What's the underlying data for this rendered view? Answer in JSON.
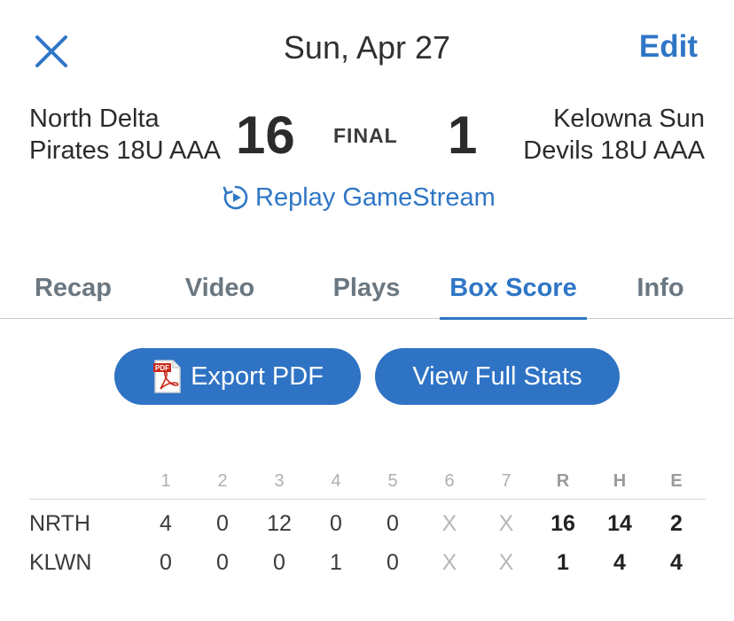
{
  "header": {
    "date": "Sun, Apr 27",
    "edit_label": "Edit",
    "close_icon": "close-icon"
  },
  "game": {
    "home_team_line1": "North Delta",
    "home_team_line2": "Pirates 18U AAA",
    "home_score": "16",
    "status": "FINAL",
    "away_score": "1",
    "away_team_line1": "Kelowna Sun",
    "away_team_line2": "Devils 18U AAA",
    "replay_label": "Replay GameStream",
    "replay_icon": "replay-icon"
  },
  "tabs": [
    {
      "label": "Recap",
      "active": false
    },
    {
      "label": "Video",
      "active": false
    },
    {
      "label": "Plays",
      "active": false
    },
    {
      "label": "Box Score",
      "active": true
    },
    {
      "label": "Info",
      "active": false
    }
  ],
  "actions": {
    "export_label": "Export PDF",
    "export_icon": "pdf-icon",
    "full_stats_label": "View Full Stats"
  },
  "box_score": {
    "headers": [
      "1",
      "2",
      "3",
      "4",
      "5",
      "6",
      "7",
      "R",
      "H",
      "E"
    ],
    "rows": [
      {
        "team": "NRTH",
        "innings": [
          "4",
          "0",
          "12",
          "0",
          "0",
          "X",
          "X"
        ],
        "r": "16",
        "h": "14",
        "e": "2"
      },
      {
        "team": "KLWN",
        "innings": [
          "0",
          "0",
          "0",
          "1",
          "0",
          "X",
          "X"
        ],
        "r": "1",
        "h": "4",
        "e": "4"
      }
    ]
  },
  "colors": {
    "accent": "#2f76c6",
    "button": "#2f73c4",
    "text": "#2b2b2b"
  }
}
